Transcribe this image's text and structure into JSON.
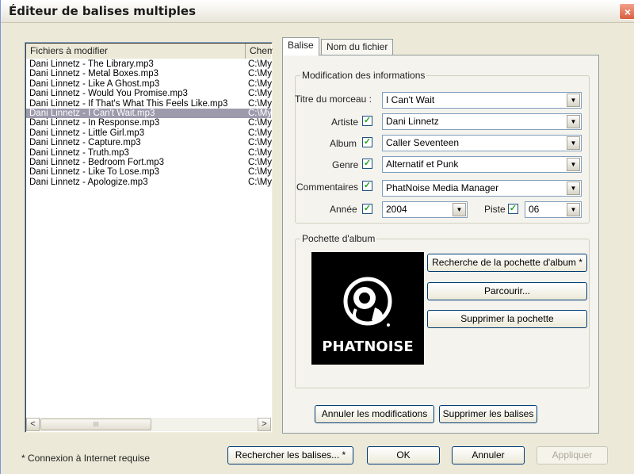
{
  "window": {
    "title": "Éditeur de balises multiples",
    "close_glyph": "×"
  },
  "filelist": {
    "columns": [
      "Fichiers à modifier",
      "Chem"
    ],
    "rows": [
      {
        "name": "Dani Linnetz - The Library.mp3",
        "path": "C:\\My"
      },
      {
        "name": "Dani Linnetz - Metal Boxes.mp3",
        "path": "C:\\My"
      },
      {
        "name": "Dani Linnetz - Like A Ghost.mp3",
        "path": "C:\\My"
      },
      {
        "name": "Dani Linnetz - Would You Promise.mp3",
        "path": "C:\\My"
      },
      {
        "name": "Dani Linnetz - If That's What This Feels Like.mp3",
        "path": "C:\\My"
      },
      {
        "name": "Dani Linnetz - I Can't Wait.mp3",
        "path": "C:\\My",
        "selected": true
      },
      {
        "name": "Dani Linnetz - In Response.mp3",
        "path": "C:\\My"
      },
      {
        "name": "Dani Linnetz - Little Girl.mp3",
        "path": "C:\\My"
      },
      {
        "name": "Dani Linnetz - Capture.mp3",
        "path": "C:\\My"
      },
      {
        "name": "Dani Linnetz - Truth.mp3",
        "path": "C:\\My"
      },
      {
        "name": "Dani Linnetz - Bedroom Fort.mp3",
        "path": "C:\\My"
      },
      {
        "name": "Dani Linnetz - Like To Lose.mp3",
        "path": "C:\\My"
      },
      {
        "name": "Dani Linnetz - Apologize.mp3",
        "path": "C:\\My"
      }
    ],
    "scroll_left": "<",
    "scroll_right": ">",
    "thumb_grip": "III"
  },
  "tabs": {
    "balise": "Balise",
    "nom_fichier": "Nom du fichier"
  },
  "info": {
    "legend": "Modification des informations",
    "title_label": "Titre du morceau :",
    "title_value": "I Can't Wait",
    "artist_label": "Artiste",
    "artist_value": "Dani Linnetz",
    "album_label": "Album",
    "album_value": "Caller Seventeen",
    "genre_label": "Genre",
    "genre_value": "Alternatif et Punk",
    "comment_label": "Commentaires",
    "comment_value": "PhatNoise Media Manager",
    "year_label": "Année",
    "year_value": "2004",
    "track_label": "Piste",
    "track_value": "06",
    "check_glyph": "✓",
    "arrow_glyph": "▼"
  },
  "album": {
    "legend": "Pochette d'album",
    "logo_text": "PHATNOISE",
    "search_button": "Recherche de la pochette d'album *",
    "browse_button": "Parcourir...",
    "remove_button": "Supprimer la pochette"
  },
  "tag_actions": {
    "cancel_changes": "Annuler les modifications",
    "delete_tags": "Supprimer les balises"
  },
  "footer": {
    "note": "* Connexion à Internet requise",
    "search_tags": "Rechercher les balises... *",
    "ok": "OK",
    "cancel": "Annuler",
    "apply": "Appliquer"
  },
  "colors": {
    "selection": "#9c9aab",
    "dialog_bg": "#ece9d8",
    "close_button": "#d95e3f"
  }
}
